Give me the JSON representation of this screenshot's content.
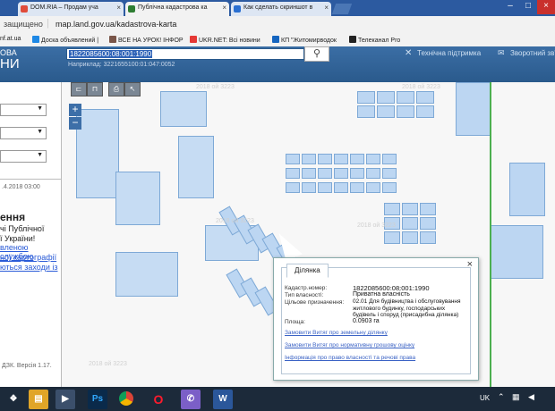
{
  "browser": {
    "tabs": [
      {
        "title": "DOM.RIA – Продам уча",
        "color": "#e04b3a"
      },
      {
        "title": "Публічна кадастрова ка",
        "color": "#2e7d32"
      },
      {
        "title": "Как сделать скриншот в",
        "color": "#2a6fd1"
      }
    ],
    "security_label": "защищено",
    "url": "map.land.gov.ua/kadastrova-karta",
    "bookmarks": [
      {
        "label": "nf.at.ua",
        "color": "#ff9800"
      },
      {
        "label": "Доска объявлений |",
        "color": "#1e88e5"
      },
      {
        "label": "ВСЕ НА УРОК! ІНФОР",
        "color": "#795548"
      },
      {
        "label": "UKR.NET: Всі новини",
        "color": "#e53935"
      },
      {
        "label": "КП \"Житомирводок",
        "color": "#1565c0"
      },
      {
        "label": "Телеканал Pro",
        "color": "#222222"
      }
    ]
  },
  "site": {
    "title_frag1": "ОВА",
    "title_frag2": "НИ",
    "search_value": "1822085600:08:001:1990",
    "search_hint": "Наприклад: 3221655100:01:047:0052",
    "support_label": "Технічна підтримка",
    "feedback_label": "Зворотний зв'я"
  },
  "sidebar": {
    "date_text": ".4.2018 03:00",
    "heading": "ення",
    "lines": [
      "чі Публічної",
      "ї України!"
    ],
    "link_lines": [
      "вленою службою",
      "ної картографії",
      "ються заходи із"
    ],
    "version_text": "ДЗК. Версія 1.17."
  },
  "map": {
    "watermarks": [
      "2018 ой 3223",
      "2018 ой 3223",
      "2018 ой 3223",
      "2018 ой 3223",
      "2018 ой 3223"
    ],
    "zoom_in": "+",
    "zoom_out": "−"
  },
  "popup": {
    "tab_label": "Ділянка",
    "close": "×",
    "rows": [
      {
        "label": "Кадастр.номер:",
        "value": "1822085600:08:001:1990"
      },
      {
        "label": "Тип власності:",
        "value": "Приватна власність"
      },
      {
        "label": "Цільове призначення:",
        "value": "02.01 Для будівництва і обслуговування житлового будинку, господарських будівель і споруд (присадибна ділянка)"
      },
      {
        "label": "Площа:",
        "value": "0.0903 га"
      }
    ],
    "links": [
      "Замовити Витяг про земельну ділянку",
      "Замовити Витяг про нормативну грошову оцінку",
      "Інформація про право власності та речові права"
    ]
  },
  "taskbar": {
    "lang": "UK",
    "apps": [
      {
        "name": "start",
        "glyph": "❖",
        "color": "#1c2a3a"
      },
      {
        "name": "explorer",
        "glyph": "▤",
        "color": "#e0a528"
      },
      {
        "name": "player",
        "glyph": "▶",
        "color": "#3b4f6b"
      },
      {
        "name": "photoshop",
        "glyph": "Ps",
        "color": "#0a2a4a"
      },
      {
        "name": "chrome",
        "glyph": "◉",
        "color": "#1c2a3a"
      },
      {
        "name": "opera",
        "glyph": "O",
        "color": "#1c2a3a"
      },
      {
        "name": "viber",
        "glyph": "✆",
        "color": "#7b5fc7"
      },
      {
        "name": "word",
        "glyph": "W",
        "color": "#2b579a"
      }
    ]
  }
}
